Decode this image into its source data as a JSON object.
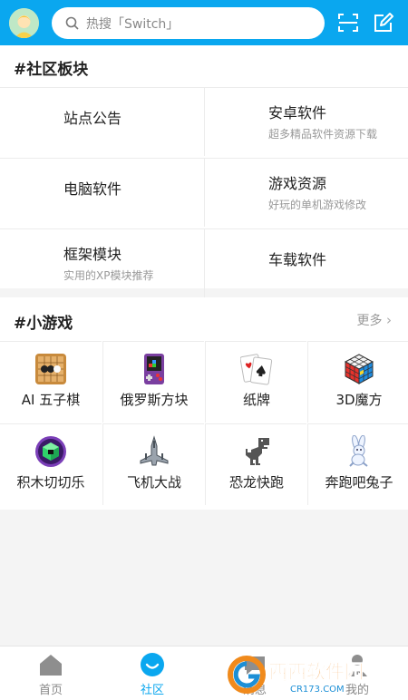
{
  "header": {
    "search_placeholder": "热搜「Switch」",
    "icons": [
      "avatar",
      "search-icon",
      "scan-icon",
      "edit-icon"
    ]
  },
  "community": {
    "title": "#社区板块",
    "items": [
      {
        "title": "站点公告",
        "subtitle": ""
      },
      {
        "title": "安卓软件",
        "subtitle": "超多精品软件资源下载"
      },
      {
        "title": "电脑软件",
        "subtitle": ""
      },
      {
        "title": "游戏资源",
        "subtitle": "好玩的单机游戏修改"
      },
      {
        "title": "框架模块",
        "subtitle": "实用的XP模块推荐"
      },
      {
        "title": "车载软件",
        "subtitle": ""
      }
    ]
  },
  "games": {
    "title": "#小游戏",
    "more_label": "更多",
    "items": [
      {
        "label": "AI 五子棋",
        "icon": "gomoku-icon"
      },
      {
        "label": "俄罗斯方块",
        "icon": "tetris-icon"
      },
      {
        "label": "纸牌",
        "icon": "cards-icon"
      },
      {
        "label": "3D魔方",
        "icon": "rubiks-cube-icon"
      },
      {
        "label": "积木切切乐",
        "icon": "block-cut-icon"
      },
      {
        "label": "飞机大战",
        "icon": "plane-icon"
      },
      {
        "label": "恐龙快跑",
        "icon": "dinosaur-icon"
      },
      {
        "label": "奔跑吧兔子",
        "icon": "rabbit-icon"
      }
    ]
  },
  "tabbar": {
    "items": [
      {
        "label": "首页",
        "icon": "home-icon",
        "active": false
      },
      {
        "label": "社区",
        "icon": "community-icon",
        "active": true
      },
      {
        "label": "消息",
        "icon": "message-icon",
        "active": false
      },
      {
        "label": "我的",
        "icon": "profile-icon",
        "active": false
      }
    ]
  },
  "watermark": {
    "text": "西西软件园",
    "subtext": "CR173.COM"
  },
  "colors": {
    "accent": "#0aa7ef",
    "header_bg": "#0aa7ef",
    "page_bg": "#f4f4f4",
    "watermark_orange": "#f08a1c",
    "watermark_blue": "#1c8fd6"
  }
}
